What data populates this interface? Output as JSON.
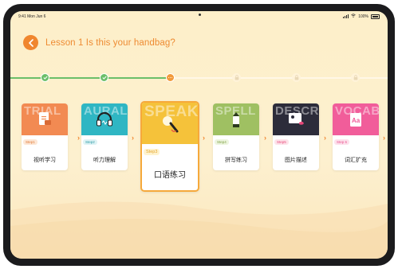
{
  "status": {
    "time": "9:41 Mon Jun 6",
    "battery": "100%"
  },
  "header": {
    "title": "Lesson 1   Is this your handbag?"
  },
  "progress": {
    "completed_steps": 2,
    "current_step": 3,
    "total_steps": 6
  },
  "colors": {
    "accent": "#f0862e",
    "done": "#6bbf6a",
    "selected_border": "#f6a93b"
  },
  "cards": [
    {
      "word": "TRIAL",
      "step": "Step1",
      "label": "视听学习",
      "color": "#f28a52",
      "icon": "document-icon"
    },
    {
      "word": "AURAL",
      "step": "Step2",
      "label": "听力理解",
      "color": "#2fb6c3",
      "icon": "headphones-icon"
    },
    {
      "word": "SPEAK",
      "step": "Step3",
      "label": "口语练习",
      "color": "#f5c23a",
      "icon": "microphone-icon"
    },
    {
      "word": "SPELL",
      "step": "Step4",
      "label": "拼写练习",
      "color": "#9fc062",
      "icon": "pencil-icon"
    },
    {
      "word": "DESCR",
      "step": "Step5",
      "label": "图片描述",
      "color": "#2c2c3a",
      "icon": "picture-icon"
    },
    {
      "word": "VOCAB",
      "step": "Step 6",
      "label": "词汇扩充",
      "color": "#f15d9a",
      "icon": "dictionary-icon"
    }
  ]
}
